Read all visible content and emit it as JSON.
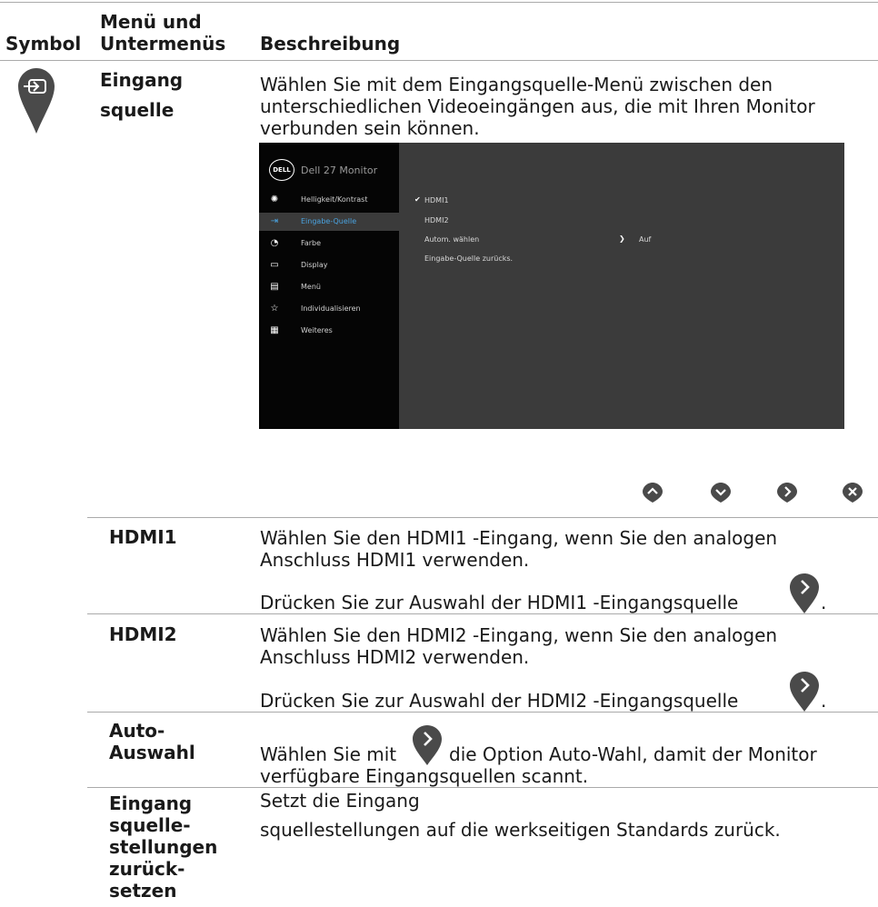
{
  "header": {
    "col_symbol": "Symbol",
    "col_menu_l1": "Menü und",
    "col_menu_l2": "Untermenüs",
    "col_desc": "Beschreibung"
  },
  "main_row": {
    "menu_l1": "Eingang",
    "menu_l2": "squelle",
    "desc_lines": [
      "Wählen Sie mit dem Eingangsquelle-Menü zwischen den",
      "unterschiedlichen Videoeingängen aus, die mit Ihren Monitor",
      "verbunden sein können."
    ]
  },
  "osd": {
    "logo": "DELL",
    "title": "Dell 27 Monitor",
    "menu_items": [
      {
        "label": "Helligkeit/Kontrast",
        "icon": "brightness-icon"
      },
      {
        "label": "Eingabe-Quelle",
        "icon": "input-source-icon",
        "selected": true
      },
      {
        "label": "Farbe",
        "icon": "color-icon"
      },
      {
        "label": "Display",
        "icon": "display-icon"
      },
      {
        "label": "Menü",
        "icon": "menu-icon"
      },
      {
        "label": "Individualisieren",
        "icon": "star-icon"
      },
      {
        "label": "Weiteres",
        "icon": "others-icon"
      }
    ],
    "options": {
      "hdmi1": "HDMI1",
      "hdmi2": "HDMI2",
      "auto": "Autom. wählen",
      "auto_value": "Auf",
      "reset": "Eingabe-Quelle zurücks."
    },
    "check_glyph": "✔",
    "chevron_glyph": "❯"
  },
  "rows": {
    "hdmi1": {
      "label": "HDMI1",
      "line1": "Wählen Sie den HDMI1 -Eingang, wenn Sie den analogen",
      "line2": "Anschluss HDMI1 verwenden.",
      "line3": "Drücken Sie zur Auswahl der HDMI1 -Eingangsquelle",
      "suffix": "."
    },
    "hdmi2": {
      "label": "HDMI2",
      "line1": "Wählen Sie den HDMI2 -Eingang, wenn Sie den analogen",
      "line2": "Anschluss HDMI2 verwenden.",
      "line3": "Drücken Sie zur Auswahl der HDMI2 -Eingangsquelle",
      "suffix": "."
    },
    "auto": {
      "label_l1": "Auto-",
      "label_l2": "Auswahl",
      "prefix": "Wählen Sie mit",
      "after": "die Option Auto-Wahl, damit der Monitor",
      "line2": "verfügbare Eingangsquellen scannt."
    },
    "reset": {
      "label_lines": [
        "Eingang",
        "squelle-",
        "stellungen",
        "zurück-",
        "setzen"
      ],
      "line1": "Setzt die Eingang",
      "line2": "squellestellungen auf die werkseitigen Standards zurück."
    }
  },
  "colors": {
    "marker": "#4a4a4a",
    "osd_bg": "#3b3b3b",
    "osd_left": "#050505",
    "accent": "#4aa3e0"
  }
}
